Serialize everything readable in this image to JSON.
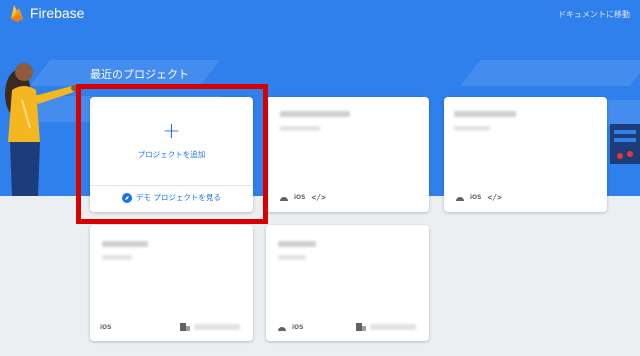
{
  "header": {
    "brand": "Firebase",
    "docs_link": "ドキュメントに移動"
  },
  "section_title": "最近のプロジェクト",
  "add_card": {
    "plus": "+",
    "label": "プロジェクトを追加",
    "demo_label": "デモ プロジェクトを見る"
  },
  "platform_labels": {
    "ios": "iOS",
    "web": "</>"
  },
  "colors": {
    "hero": "#2f80ed",
    "accent": "#1a73e8",
    "highlight": "#d70000",
    "page_bg": "#eceff1"
  },
  "icons": {
    "logo": "firebase-flame-icon",
    "demo": "compass-icon",
    "android": "android-icon",
    "analytics": "analytics-building-icon"
  }
}
